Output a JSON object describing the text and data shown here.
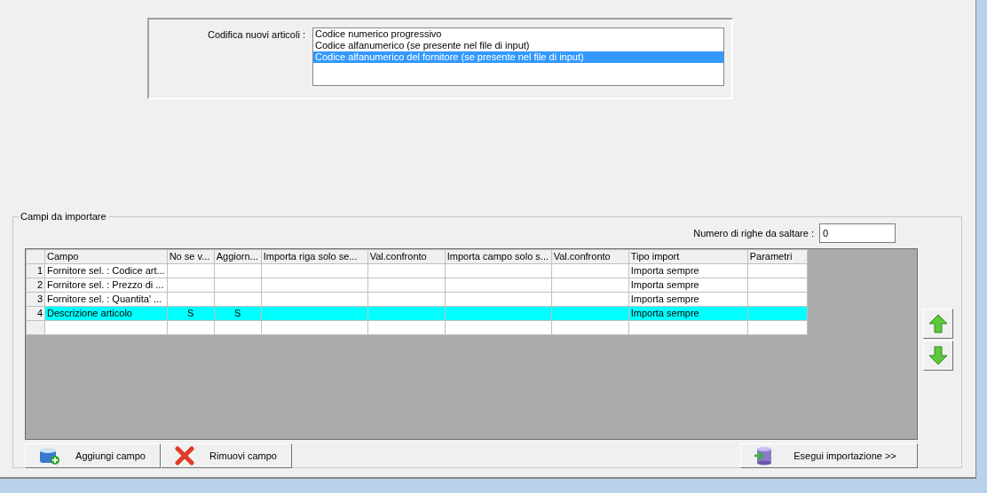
{
  "coding": {
    "label": "Codifica nuovi articoli :",
    "options": [
      {
        "label": "Codice numerico progressivo",
        "selected": false
      },
      {
        "label": "Codice alfanumerico (se presente nel file di input)",
        "selected": false
      },
      {
        "label": "Codice alfanumerico del fornitore (se presente nel file di input)",
        "selected": true
      }
    ]
  },
  "fields_group": {
    "title": "Campi da importare",
    "skip_rows": {
      "label": "Numero di righe da saltare  :",
      "value": "0"
    },
    "table": {
      "columns": [
        "Campo",
        "No se v...",
        "Aggiorn...",
        "Importa riga solo se...",
        "Val.confronto",
        "Importa campo solo s...",
        "Val.confronto",
        "Tipo import",
        "Parametri"
      ],
      "rows": [
        {
          "number": "1",
          "campo": "Fornitore sel. : Codice art...",
          "tipo_import": "Importa sempre",
          "selected": false
        },
        {
          "number": "2",
          "campo": "Fornitore sel. : Prezzo di ...",
          "tipo_import": "Importa sempre",
          "selected": false
        },
        {
          "number": "3",
          "campo": "Fornitore sel. : Quantita' ...",
          "tipo_import": "Importa sempre",
          "selected": false
        },
        {
          "number": "4",
          "campo": "Descrizione articolo",
          "no_se_v": "S",
          "aggiorn": "S",
          "tipo_import": "Importa sempre",
          "selected": true
        }
      ]
    },
    "buttons": [
      {
        "label": "Aggiungi campo",
        "kind": "add"
      },
      {
        "label": "Rimuovi campo",
        "kind": "remove"
      },
      {
        "label": "Esegui importazione >>",
        "kind": "run"
      }
    ]
  }
}
